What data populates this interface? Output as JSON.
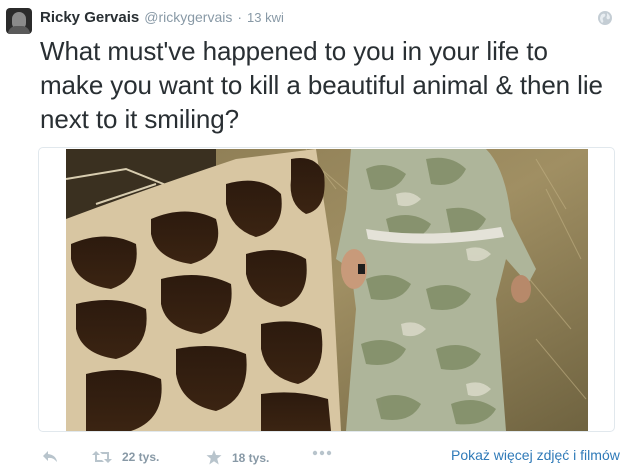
{
  "tweet": {
    "author": {
      "name": "Ricky Gervais",
      "handle": "@rickygervais",
      "separator": "·",
      "time": "13 kwi"
    },
    "text": "What must've happened to you in your life to make you want to kill a beautiful animal & then lie next to it smiling?",
    "icons": {
      "avatar": "profile-photo",
      "privacy": "globe-icon",
      "reply": "reply-icon",
      "retweet": "retweet-icon",
      "favorite": "star-icon",
      "more": "more-dots-icon"
    },
    "stats": {
      "retweets": "22 tys.",
      "favorites": "18 tys."
    },
    "show_more_label": "Pokaż więcej zdjęć i filmów"
  },
  "colors": {
    "text": "#292f33",
    "muted": "#8899a6",
    "link": "#2f7ab8",
    "border": "#e1e8ed",
    "icon_gray": "#b8c4cc"
  }
}
